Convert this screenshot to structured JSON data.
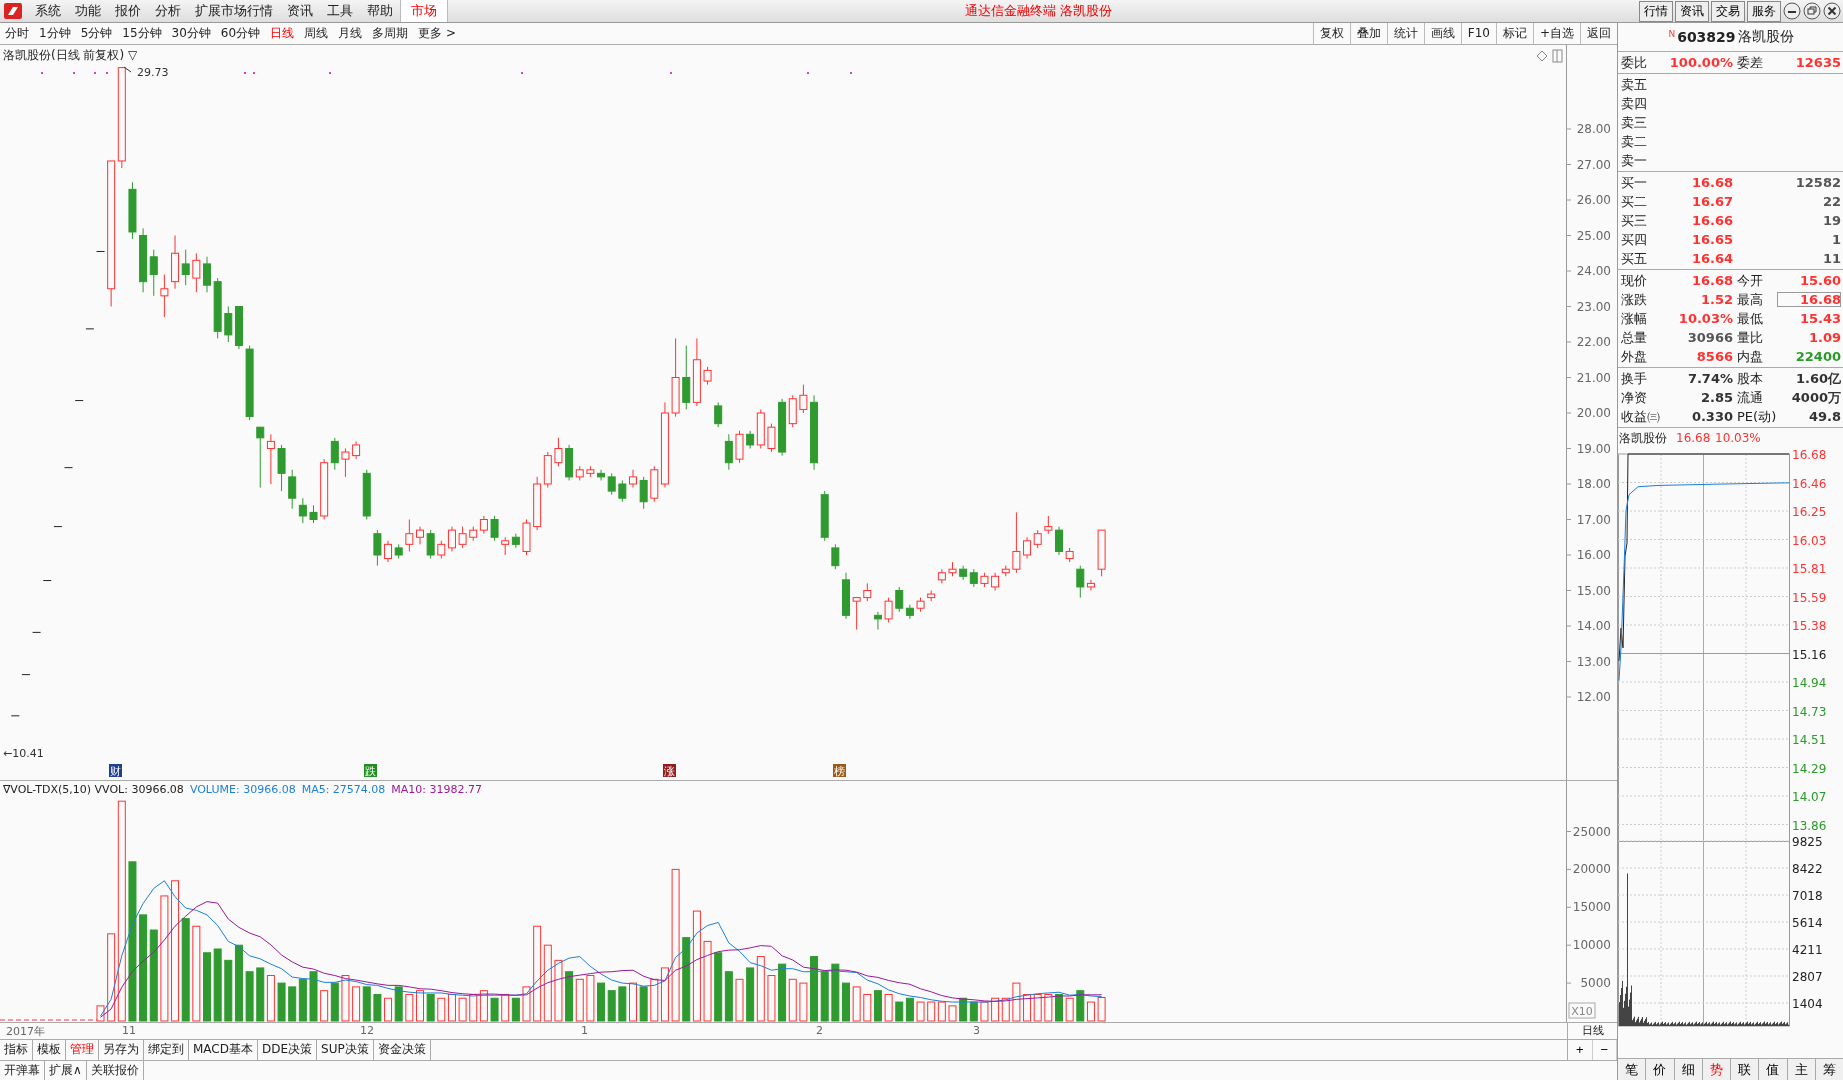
{
  "title_bar": {
    "app_title": "通达信金融终端 洛凯股份",
    "menu": [
      "系统",
      "功能",
      "报价",
      "分析",
      "扩展市场行情",
      "资讯",
      "工具",
      "帮助"
    ],
    "market_button": "市场",
    "right_buttons": [
      "行情",
      "资讯",
      "交易",
      "服务"
    ]
  },
  "periods": [
    {
      "label": "分时",
      "selected": false
    },
    {
      "label": "1分钟",
      "selected": false
    },
    {
      "label": "5分钟",
      "selected": false
    },
    {
      "label": "15分钟",
      "selected": false
    },
    {
      "label": "30分钟",
      "selected": false
    },
    {
      "label": "60分钟",
      "selected": false
    },
    {
      "label": "日线",
      "selected": true
    },
    {
      "label": "周线",
      "selected": false
    },
    {
      "label": "月线",
      "selected": false
    },
    {
      "label": "多周期",
      "selected": false
    },
    {
      "label": "更多 >",
      "selected": false
    }
  ],
  "chart_tools": [
    "复权",
    "叠加",
    "统计",
    "画线",
    "F10",
    "标记",
    "+自选",
    "返回"
  ],
  "main_chart": {
    "title": "洛凯股份(日线 前复权) ▽",
    "high_label": "29.73",
    "low_label": "←10.41",
    "y_ticks": [
      "28.00",
      "27.00",
      "26.00",
      "25.00",
      "24.00",
      "23.00",
      "22.00",
      "21.00",
      "20.00",
      "19.00",
      "18.00",
      "17.00",
      "16.00",
      "15.00",
      "14.00",
      "13.00",
      "12.00"
    ],
    "event_tags": [
      {
        "label": "财",
        "color": "#1f3f8f"
      },
      {
        "label": "跌",
        "color": "#1f8f1f"
      },
      {
        "label": "涨",
        "color": "#8f1f1f"
      },
      {
        "label": "榜",
        "color": "#9a5a1a"
      }
    ]
  },
  "volume_chart": {
    "indicator": "∇VOL-TDX(5,10) VVOL: 30966.08",
    "readings": [
      {
        "text": "VOLUME: 30966.08",
        "color": "#1e7fd8"
      },
      {
        "text": "MA5: 27574.08",
        "color": "#1e7fd8"
      },
      {
        "text": "MA10: 31982.77",
        "color": "#9a1a9a"
      }
    ],
    "y_ticks": [
      "25000",
      "20000",
      "15000",
      "10000",
      "5000"
    ],
    "scale": "X10"
  },
  "date_axis": [
    "2017年",
    "11",
    "12",
    "1",
    "2",
    "3"
  ],
  "period_label": "日线",
  "zoom_buttons": [
    "+",
    "−"
  ],
  "bottom_tabs": [
    {
      "label": "指标",
      "selected": false
    },
    {
      "label": "模板",
      "selected": false
    },
    {
      "label": "管理",
      "selected": true
    },
    {
      "label": "另存为",
      "selected": false
    },
    {
      "label": "绑定到",
      "selected": false
    },
    {
      "label": "MACD基本",
      "selected": false
    },
    {
      "label": "DDE决策",
      "selected": false
    },
    {
      "label": "SUP决策",
      "selected": false
    },
    {
      "label": "资金决策",
      "selected": false
    }
  ],
  "bottom_tabs_2": [
    "开弹幕",
    "扩展∧",
    "关联报价"
  ],
  "stock_header": {
    "market_mark": "N",
    "code": "603829",
    "name": "洛凯股份"
  },
  "order_summary": [
    {
      "label": "委比",
      "value": "100.00%"
    },
    {
      "label": "委差",
      "value": "12635"
    }
  ],
  "sell_levels": [
    "卖五",
    "卖四",
    "卖三",
    "卖二",
    "卖一"
  ],
  "buy_levels": [
    {
      "label": "买一",
      "price": "16.68",
      "volume": "12582"
    },
    {
      "label": "买二",
      "price": "16.67",
      "volume": "22"
    },
    {
      "label": "买三",
      "price": "16.66",
      "volume": "19"
    },
    {
      "label": "买四",
      "price": "16.65",
      "volume": "1"
    },
    {
      "label": "买五",
      "price": "16.64",
      "volume": "11"
    }
  ],
  "stats": [
    {
      "label": "现价",
      "value": "16.68",
      "color": "#ff3232",
      "boxed": false
    },
    {
      "label": "今开",
      "value": "15.60",
      "color": "#ff3232",
      "boxed": false
    },
    {
      "label": "涨跌",
      "value": "1.52",
      "color": "#ff3232",
      "boxed": false
    },
    {
      "label": "最高",
      "value": "16.68",
      "color": "#ff3232",
      "boxed": true
    },
    {
      "label": "涨幅",
      "value": "10.03%",
      "color": "#ff3232",
      "boxed": false
    },
    {
      "label": "最低",
      "value": "15.43",
      "color": "#ff3232",
      "boxed": false
    },
    {
      "label": "总量",
      "value": "30966",
      "color": "#555555",
      "boxed": false
    },
    {
      "label": "量比",
      "value": "1.09",
      "color": "#ff3232",
      "boxed": false
    },
    {
      "label": "外盘",
      "value": "8566",
      "color": "#ff3232",
      "boxed": false
    },
    {
      "label": "内盘",
      "value": "22400",
      "color": "#2a9a2a",
      "boxed": false
    }
  ],
  "fundamentals": [
    {
      "label": "换手",
      "value": "7.74%"
    },
    {
      "label": "股本",
      "value": "1.60亿"
    },
    {
      "label": "净资",
      "value": "2.85"
    },
    {
      "label": "流通",
      "value": "4000万"
    },
    {
      "label": "收益㈢",
      "value": "0.330"
    },
    {
      "label": "PE(动)",
      "value": "49.8"
    }
  ],
  "intraday": {
    "name": "洛凯股份",
    "price": "16.68",
    "change": "10.03%",
    "price_ticks": [
      {
        "label": "16.68",
        "color": "#ff3232"
      },
      {
        "label": "16.46",
        "color": "#ff3232"
      },
      {
        "label": "16.25",
        "color": "#ff3232"
      },
      {
        "label": "16.03",
        "color": "#ff3232"
      },
      {
        "label": "15.81",
        "color": "#ff3232"
      },
      {
        "label": "15.59",
        "color": "#ff3232"
      },
      {
        "label": "15.38",
        "color": "#ff3232"
      },
      {
        "label": "15.16",
        "color": "#222222"
      },
      {
        "label": "14.94",
        "color": "#2a9a2a"
      },
      {
        "label": "14.73",
        "color": "#2a9a2a"
      },
      {
        "label": "14.51",
        "color": "#2a9a2a"
      },
      {
        "label": "14.29",
        "color": "#2a9a2a"
      },
      {
        "label": "14.07",
        "color": "#2a9a2a"
      },
      {
        "label": "13.86",
        "color": "#2a9a2a"
      }
    ],
    "volume_ticks": [
      "9825",
      "8422",
      "7018",
      "5614",
      "4211",
      "2807",
      "1404"
    ]
  },
  "intraday_tabs": [
    {
      "label": "笔",
      "selected": false
    },
    {
      "label": "价",
      "selected": false
    },
    {
      "label": "细",
      "selected": false
    },
    {
      "label": "势",
      "selected": true
    },
    {
      "label": "联",
      "selected": false
    },
    {
      "label": "值",
      "selected": false
    },
    {
      "label": "主",
      "selected": false
    },
    {
      "label": "筹",
      "selected": false
    }
  ]
}
